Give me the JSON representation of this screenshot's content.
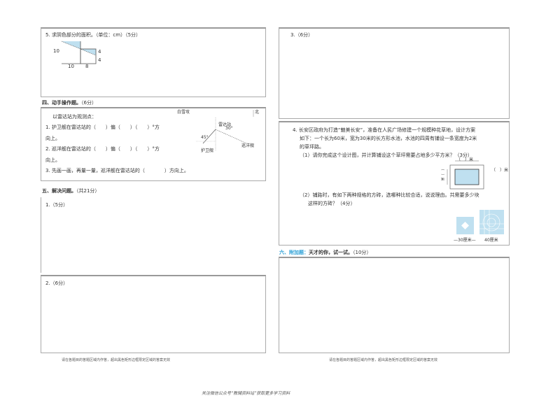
{
  "left": {
    "q5": {
      "title": "5. 求阴色部分的面积。（单位：cm）（5分）",
      "labels": [
        "10",
        "4",
        "4",
        "10",
        "8"
      ]
    },
    "section4": {
      "heading": "四、动手操作题。",
      "score": "（6分）"
    },
    "radar": {
      "intro": "以雷达站为观测点：",
      "q1a": "1. 护卫舰在雷达站的（　　）偏（　　）（　　）°方",
      "q1b": "向上。",
      "q2a": "2. 巡洋舰在雷达站的（　　）偏（　　）（　　）°方",
      "q2b": "向上。",
      "q3": "3. 先画一画，再量一量，巡洋舰在雷达站的（　　　　）方向上。",
      "map_labels": {
        "north_mark": "北",
        "top": "白雪攻",
        "station": "雷达站",
        "angle1": "30°",
        "angle2": "45°",
        "ship1": "巡洋舰",
        "ship2": "护卫舰"
      }
    },
    "section5": {
      "heading": "五、解决问题。",
      "score": "（共21分）"
    },
    "p1": "1.（5分）",
    "p2": "2.（6分）",
    "footer": "请在各题目的答题区域内作答，超出黑色矩形边框限定区域的答案无效"
  },
  "right": {
    "q3": "3.（6分）",
    "q4": {
      "l1": "4. 长安区政府为打造“魅美长安”，准备在人民广场修建一个规模种花草地，设计方案",
      "l2": "如下：一个长为60米，宽为30米的长方形水池，水池的四周有铺设一条宽度为2米",
      "l3": "的草坪路。",
      "s1": "（1）请你完成这个设计图，并计算铺设这个草坪需要占地多少平方米？（3分）",
      "fig1": {
        "top": "（　）米",
        "right": "（　）米",
        "left": "（　）米"
      },
      "s2a": "（2）铺路时，有如下两种规格的方砖，选哪种比较合适，说说理由。共需要多少块",
      "s2b": "这样的方砖？（4分）",
      "tile1": "30厘米",
      "tile2": "40厘米"
    },
    "section6": {
      "prefix": "六、附加题：",
      "heading": "天才的你，试一试。",
      "score": "（10分）"
    },
    "footer": "请在各题目的答题区域内作答，超出黑色矩形边框限定区域的答案无效"
  },
  "bottom_note": "关注微信公众号“教辅资料站”获取更多学习资料",
  "colors": {
    "fill": "#bfe0f0",
    "accent": "#2a9fd6"
  }
}
